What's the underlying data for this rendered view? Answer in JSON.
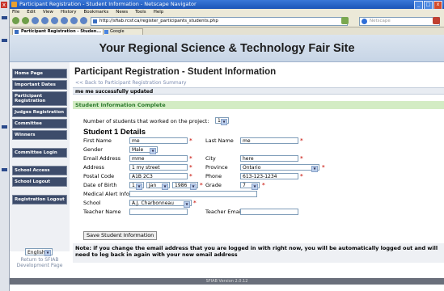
{
  "browser": {
    "title": "Participant Registration - Student Information - Netscape Navigator",
    "window_buttons": [
      "_",
      "□",
      "x"
    ],
    "menu": [
      "File",
      "Edit",
      "View",
      "History",
      "Bookmarks",
      "News",
      "Tools",
      "Help"
    ],
    "url": "http://sfiab.rcsf.ca/register_participants_students.php",
    "search_placeholder": "Netscape",
    "tabs": [
      "Participant Registration - Studen...",
      "Google"
    ]
  },
  "site": {
    "title": "Your Regional Science & Technology Fair Site"
  },
  "sidebar": {
    "items": [
      "Home Page",
      "Important Dates",
      "Participant Registration",
      "Judges Registration",
      "Committee",
      "Winners",
      "Committee Login",
      "School Access",
      "School Logout",
      "Registration Logout"
    ],
    "language": "English",
    "footer": "Return to SFIAB Development Page"
  },
  "page": {
    "title": "Participant Registration - Student Information",
    "back_link": "<< Back to Participant Registration Summary",
    "message": "me me successfully updated",
    "section": "Student Information Complete",
    "num_students_label": "Number of students that worked on the project:",
    "num_students": "1",
    "student_heading": "Student 1 Details"
  },
  "form": {
    "first_name_label": "First Name",
    "first_name": "me",
    "last_name_label": "Last Name",
    "last_name": "me",
    "gender_label": "Gender",
    "gender": "Male",
    "email_label": "Email Address",
    "email": "mme",
    "city_label": "City",
    "city": "here",
    "address_label": "Address",
    "address": "1 my street",
    "province_label": "Province",
    "province": "Ontario",
    "postal_label": "Postal Code",
    "postal": "A1B 2C3",
    "phone_label": "Phone",
    "phone": "613-123-1234",
    "dob_label": "Date of Birth",
    "dob_day": "1",
    "dob_month": "Jan",
    "dob_year": "1986",
    "grade_label": "Grade",
    "grade": "7",
    "medical_label": "Medical Alert Info",
    "medical": "",
    "school_label": "School",
    "school": "A.J. Charbonneau",
    "teacher_name_label": "Teacher Name",
    "teacher_name": "",
    "teacher_email_label": "Teacher Email",
    "teacher_email": "",
    "required_mark": "*",
    "save_label": "Save Student Information"
  },
  "note": "Note: if you change the email address that you are logged in with right now, you will be automatically logged out and will need to log back in again with your new email address",
  "footer": {
    "version": "SFIAB Version 2.0.12"
  },
  "colors": {
    "sidebar_button": "#3d4c6b",
    "section_green": "#d3ecc4",
    "required_red": "#d0342c",
    "header_band": "#c7d5e6"
  }
}
